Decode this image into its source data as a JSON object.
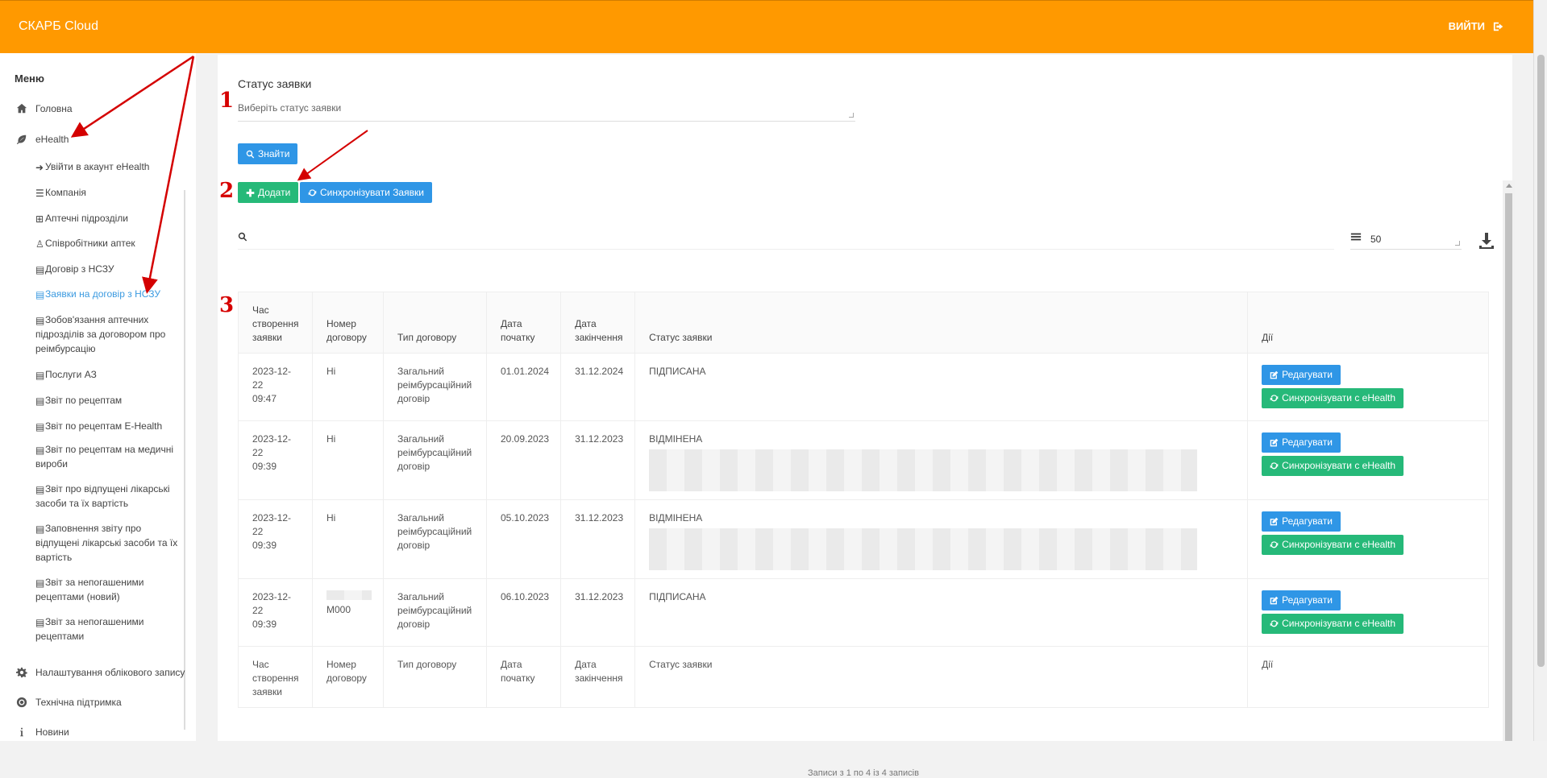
{
  "header": {
    "brand": "СКАРБ Cloud",
    "logout_label": "ВИЙТИ"
  },
  "sidebar": {
    "menu_title": "Меню",
    "main_items": [
      {
        "label": "Головна",
        "icon": "home-icon"
      },
      {
        "label": "eHealth",
        "icon": "leaf-icon"
      },
      {
        "label": "Налаштування облікового запису",
        "icon": "gear-icon"
      },
      {
        "label": "Технічна підтримка",
        "icon": "lifebuoy-icon"
      },
      {
        "label": "Новини",
        "icon": "info-icon"
      }
    ],
    "sub_items": [
      "Увійти в акаунт eHealth",
      "Компанія",
      "Аптечні підрозділи",
      "Співробітники аптек",
      "Договір з НСЗУ",
      "Заявки на договір з НСЗУ",
      "Зобов'язання аптечних підрозділів за договором про реімбурсацію",
      "Послуги АЗ",
      "Звіт по рецептам",
      "Звіт по рецептам E-Health",
      "Звіт по рецептам на медичні вироби",
      "Звіт про відпущені лікарські засоби та їх вартість",
      "Заповнення звіту про відпущені лікарські засоби та їх вартість",
      "Звіт за непогашеними рецептами (новий)",
      "Звіт за непогашеними рецептами"
    ]
  },
  "filter": {
    "status_label": "Статус заявки",
    "status_placeholder": "Виберіть статус заявки",
    "find_button": "Знайти"
  },
  "actions": {
    "add_button": "Додати",
    "sync_button": "Синхронізувати Заявки"
  },
  "table": {
    "per_page": "50",
    "columns": [
      "Час створення заявки",
      "Номер договору",
      "Тип договору",
      "Дата початку",
      "Дата закінчення",
      "Статус заявки",
      "Дії"
    ],
    "rows": [
      {
        "created_date": "2023-12-22",
        "created_time": "09:47",
        "number": "Ні",
        "type": "Загальний реімбурсаційний договір",
        "start": "01.01.2024",
        "end": "31.12.2024",
        "status": "ПІДПИСАНА"
      },
      {
        "created_date": "2023-12-22",
        "created_time": "09:39",
        "number": "Ні",
        "type": "Загальний реімбурсаційний договір",
        "start": "20.09.2023",
        "end": "31.12.2023",
        "status": "ВІДМІНЕНА"
      },
      {
        "created_date": "2023-12-22",
        "created_time": "09:39",
        "number": "Ні",
        "type": "Загальний реімбурсаційний договір",
        "start": "05.10.2023",
        "end": "31.12.2023",
        "status": "ВІДМІНЕНА"
      },
      {
        "created_date": "2023-12-22",
        "created_time": "09:39",
        "number": "M000",
        "type": "Загальний реімбурсаційний договір",
        "start": "06.10.2023",
        "end": "31.12.2023",
        "status": "ПІДПИСАНА"
      }
    ],
    "edit_button": "Редагувати",
    "sync_row_button": "Синхронізувати с eHealth",
    "summary": "Записи з 1 по 4 із 4 записів"
  },
  "annotations": [
    "1",
    "2",
    "3"
  ]
}
